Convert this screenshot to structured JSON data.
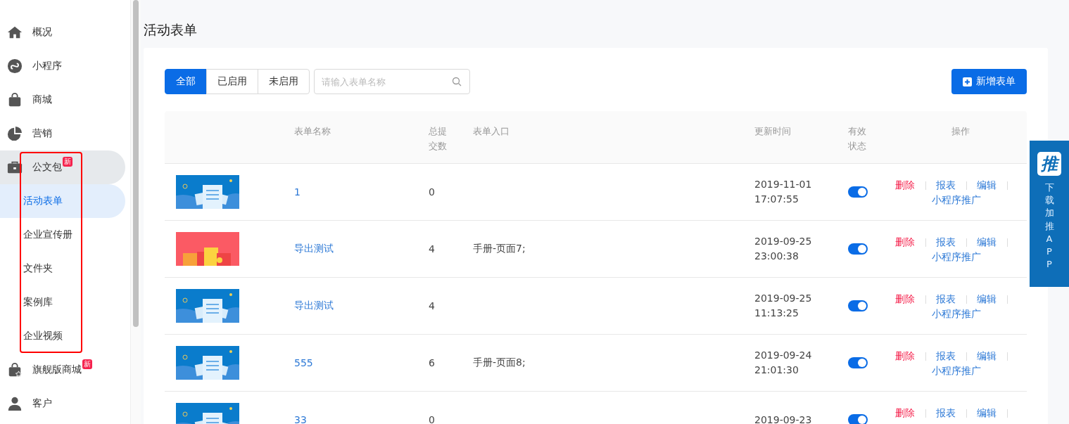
{
  "sidebar": {
    "items": [
      {
        "label": "概况",
        "selected": false
      },
      {
        "label": "小程序",
        "selected": false
      },
      {
        "label": "商城",
        "selected": false
      },
      {
        "label": "营销",
        "selected": false
      },
      {
        "label": "公文包",
        "selected": true,
        "badge": "新",
        "highlighted": true,
        "children": [
          {
            "label": "活动表单",
            "selected": true
          },
          {
            "label": "企业宣传册",
            "selected": false
          },
          {
            "label": "文件夹",
            "selected": false
          },
          {
            "label": "案例库",
            "selected": false
          },
          {
            "label": "企业视频",
            "selected": false
          }
        ]
      },
      {
        "label": "旗舰版商城",
        "selected": false,
        "badge": "新"
      },
      {
        "label": "客户",
        "selected": false
      }
    ]
  },
  "page_title": "活动表单",
  "filters": [
    {
      "label": "全部",
      "selected": true
    },
    {
      "label": "已启用",
      "selected": false
    },
    {
      "label": "未启用",
      "selected": false
    }
  ],
  "search": {
    "placeholder": "请输入表单名称"
  },
  "add_button": "新增表单",
  "table": {
    "columns": [
      "表单名称",
      "总提交数",
      "表单入口",
      "更新时间",
      "有效状态",
      "操作"
    ],
    "rows": [
      {
        "kind": "form",
        "name": "1",
        "count": "0",
        "date": "2019-11-01",
        "time": "17:07:55",
        "on": true,
        "actions": [
          {
            "label": "删除",
            "kind": "danger"
          },
          {
            "label": "报表",
            "kind": "link"
          },
          {
            "label": "编辑",
            "kind": "link"
          },
          {
            "label": "小程序推广",
            "kind": "link"
          }
        ]
      },
      {
        "kind": "envelope",
        "name": "导出测试",
        "count": "4",
        "entry": "手册-页面7;",
        "date": "2019-09-25",
        "time": "23:00:38",
        "on": true,
        "actions": [
          {
            "label": "删除",
            "kind": "danger"
          },
          {
            "label": "报表",
            "kind": "link"
          },
          {
            "label": "编辑",
            "kind": "link"
          },
          {
            "label": "小程序推广",
            "kind": "link"
          }
        ]
      },
      {
        "kind": "form",
        "name": "导出测试",
        "count": "4",
        "date": "2019-09-25",
        "time": "11:13:25",
        "on": true,
        "actions": [
          {
            "label": "删除",
            "kind": "danger"
          },
          {
            "label": "报表",
            "kind": "link"
          },
          {
            "label": "编辑",
            "kind": "link"
          },
          {
            "label": "小程序推广",
            "kind": "link"
          }
        ]
      },
      {
        "kind": "form",
        "name": "555",
        "count": "6",
        "entry": "手册-页面8;",
        "date": "2019-09-24",
        "time": "21:01:30",
        "on": true,
        "actions": [
          {
            "label": "删除",
            "kind": "danger"
          },
          {
            "label": "报表",
            "kind": "link"
          },
          {
            "label": "编辑",
            "kind": "link"
          },
          {
            "label": "小程序推广",
            "kind": "link"
          }
        ]
      },
      {
        "kind": "form",
        "name": "33",
        "count": "0",
        "date": "2019-09-23",
        "on": true,
        "actions": [
          {
            "label": "删除",
            "kind": "danger"
          },
          {
            "label": "报表",
            "kind": "link"
          },
          {
            "label": "编辑",
            "kind": "link"
          }
        ]
      }
    ]
  },
  "promo": {
    "logo": "推",
    "text": "下载加推APP"
  }
}
